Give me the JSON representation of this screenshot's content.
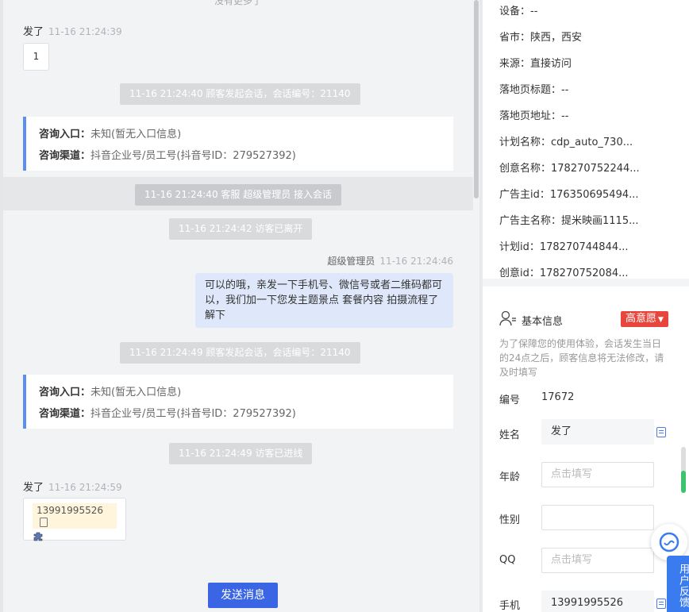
{
  "chat": {
    "no_more": "没有更多了",
    "msg1": {
      "sender": "发了",
      "time": "11-16 21:24:39",
      "text": "1"
    },
    "sys1": "11-16 21:24:40 顾客发起会话，会话编号：21140",
    "card1": {
      "entry_label": "咨询入口：",
      "entry_value": "未知(暂无入口信息)",
      "channel_label": "咨询渠道：",
      "channel_value": "抖音企业号/员工号(抖音号ID：279527392)"
    },
    "sys2": "11-16 21:24:40 客服 超级管理员 接入会话",
    "sys3": "11-16 21:24:42 访客已离开",
    "agent_msg": {
      "sender": "超级管理员",
      "time": "11-16 21:24:46",
      "text": "可以的哦，亲发一下手机号、微信号或者二维码都可以，我们加一下您发主题景点 套餐内容 拍摄流程了解下"
    },
    "sys4": "11-16 21:24:49 顾客发起会话，会话编号：21140",
    "card2": {
      "entry_label": "咨询入口：",
      "entry_value": "未知(暂无入口信息)",
      "channel_label": "咨询渠道：",
      "channel_value": "抖音企业号/员工号(抖音号ID：279527392)"
    },
    "sys5": "11-16 21:24:49 访客已进线",
    "msg2": {
      "sender": "发了",
      "time": "11-16 21:24:59",
      "phone": "13991995526"
    },
    "send_label": "发送消息"
  },
  "panel": {
    "rows": [
      "设备：--",
      "省市：陕西，西安",
      "来源：直接访问",
      "落地页标题：--",
      "落地页地址：--",
      "计划名称：cdp_auto_730...",
      "创意名称：178270752244...",
      "广告主id：176350695494...",
      "广告主名称：提米映画1115...",
      "计划id：178270744844...",
      "创意id：178270752084..."
    ],
    "basic_info_title": "基本信息",
    "intent_badge": "高意愿",
    "note": "为了保障您的使用体验，会话发生当日的24点之后，顾客信息将无法修改，请及时填写",
    "id_label": "编号",
    "id_value": "17672",
    "name_label": "姓名",
    "name_value": "发了",
    "age_label": "年龄",
    "age_placeholder": "点击填写",
    "gender_label": "性别",
    "qq_label": "QQ",
    "qq_placeholder": "点击填写",
    "phone_label": "手机",
    "phone_value": "13991995526"
  },
  "feedback": {
    "label": "用户反馈"
  },
  "colors": {
    "accent": "#3a66e6",
    "badge": "#e8453c",
    "agent_bubble": "#dfe8fa",
    "card_border": "#5b8ff0"
  }
}
